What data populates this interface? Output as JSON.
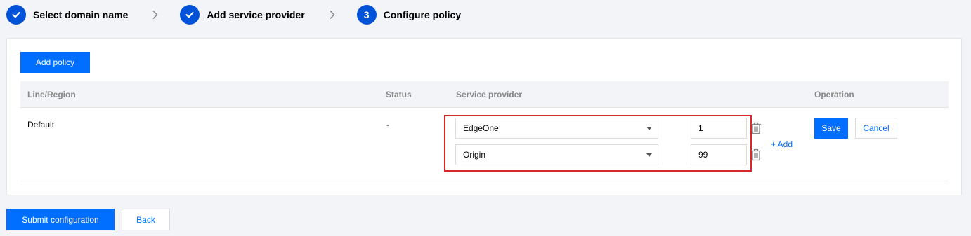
{
  "steps": [
    {
      "label": "Select domain name",
      "state": "done",
      "icon": "check-icon"
    },
    {
      "label": "Add service provider",
      "state": "done",
      "icon": "check-icon"
    },
    {
      "label": "Configure policy",
      "state": "current",
      "number": "3"
    }
  ],
  "card": {
    "add_policy_label": "Add policy",
    "columns": {
      "line_region": "Line/Region",
      "status": "Status",
      "service_provider": "Service provider",
      "operation": "Operation"
    },
    "row": {
      "line_region": "Default",
      "status": "-",
      "providers": [
        {
          "name": "EdgeOne",
          "weight": "1"
        },
        {
          "name": "Origin",
          "weight": "99"
        }
      ],
      "add_label": "+ Add",
      "save_label": "Save",
      "cancel_label": "Cancel"
    }
  },
  "footer": {
    "submit_label": "Submit configuration",
    "back_label": "Back"
  },
  "colors": {
    "primary": "#006eff",
    "step_circle": "#0052d9",
    "highlight": "#d9252c"
  }
}
